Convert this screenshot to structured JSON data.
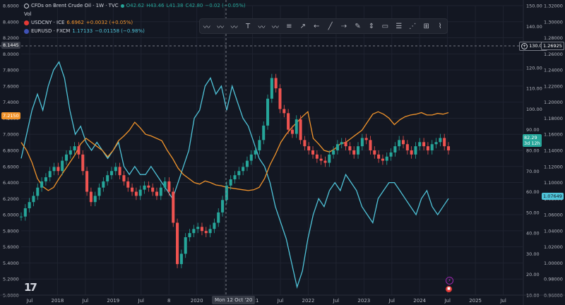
{
  "legend": {
    "main": {
      "title": "CFDs on Brent Crude Oil · 1W · TVC",
      "o": "O42.62",
      "h": "H43.46",
      "l": "L41.38",
      "c": "C42.80",
      "chg": "−0.02 (−0.05%)"
    },
    "vol": "Vol",
    "usdcny": {
      "name": "USDCNY · ICE",
      "value": "6.6962",
      "chg": "+0.0032 (+0.05%)"
    },
    "eurusd": {
      "name": "EURUSD · FXCM",
      "value": "1.17133",
      "chg": "−0.01158 (−0.98%)"
    }
  },
  "toolbar_icons": [
    "wave-icon",
    "wave-icon",
    "wave-icon",
    "text-tool-icon",
    "wave-icon",
    "wave-icon",
    "lines-icon",
    "arrow-diagonal-icon",
    "arrow-left-icon",
    "line-icon",
    "arrow-line-icon",
    "brush-icon",
    "price-range-icon",
    "rectangle-icon",
    "fib-icon",
    "fan-icon",
    "gann-icon",
    "path-icon"
  ],
  "crosshair": {
    "price": "130.05",
    "eur": "1.26925",
    "cny": "8.1445",
    "date": "Mon 12 Oct '20"
  },
  "tags": {
    "usdcny_last": "7.2150",
    "brent_last": "82.29",
    "brent_countdown": "3d 12h",
    "eurusd_last": "1.07649"
  },
  "colors": {
    "bg": "#131722",
    "grid": "#1f2330",
    "up": "#26a69a",
    "down": "#ef5350",
    "usdcny": "#f0932b",
    "eurusd": "#4fc3d8",
    "text": "#b2b5be"
  },
  "chart_data": {
    "type": "line",
    "title": "CFDs on Brent Crude Oil · 1W · TVC",
    "x_ticks": [
      "Jul",
      "2018",
      "Jul",
      "2019",
      "Jul",
      "8",
      "2020",
      "Jul",
      "2021",
      "Jul",
      "2022",
      "Jul",
      "2023",
      "Jul",
      "2024",
      "Jul",
      "2025",
      "Jul"
    ],
    "axes": {
      "usdcny_left": {
        "ticks": [
          "8.6000",
          "8.4000",
          "8.2000",
          "8.0000",
          "7.8000",
          "7.6000",
          "7.4000",
          "7.2000",
          "7.0000",
          "6.8000",
          "6.6000",
          "6.4000",
          "6.2000",
          "6.0000",
          "5.8000",
          "5.6000",
          "5.4000",
          "5.2000",
          "5.0000"
        ],
        "ylim": [
          5.0,
          8.6
        ]
      },
      "brent_right": {
        "ticks": [
          "150.00",
          "140.00",
          "130.00",
          "120.00",
          "110.00",
          "100.00",
          "90.00",
          "80.00",
          "70.00",
          "60.00",
          "50.00",
          "40.00",
          "30.00",
          "20.00",
          "10.00"
        ],
        "ylim": [
          10,
          150
        ]
      },
      "eurusd_right": {
        "ticks": [
          "1.32000",
          "1.30000",
          "1.28000",
          "1.26000",
          "1.24000",
          "1.22000",
          "1.20000",
          "1.18000",
          "1.16000",
          "1.14000",
          "1.12000",
          "1.10000",
          "1.08000",
          "1.06000",
          "1.04000",
          "1.02000",
          "1.00000",
          "0.98000",
          "0.96000"
        ],
        "ylim": [
          0.96,
          1.32
        ]
      }
    },
    "series": [
      {
        "name": "USDCNY",
        "values": [
          6.9,
          6.8,
          6.65,
          6.45,
          6.35,
          6.3,
          6.34,
          6.45,
          6.55,
          6.65,
          6.75,
          6.88,
          6.95,
          6.9,
          6.85,
          6.8,
          6.72,
          6.8,
          6.92,
          6.98,
          7.05,
          7.15,
          7.08,
          7.0,
          6.98,
          6.95,
          6.92,
          6.8,
          6.7,
          6.58,
          6.5,
          6.45,
          6.4,
          6.38,
          6.42,
          6.4,
          6.37,
          6.36,
          6.34,
          6.33,
          6.32,
          6.31,
          6.3,
          6.31,
          6.34,
          6.45,
          6.62,
          6.75,
          6.9,
          7.0,
          7.08,
          7.15,
          7.22,
          7.28,
          6.95,
          6.88,
          6.8,
          6.78,
          6.82,
          6.88,
          6.9,
          6.95,
          7.0,
          7.05,
          7.15,
          7.25,
          7.28,
          7.25,
          7.2,
          7.12,
          7.18,
          7.22,
          7.24,
          7.25,
          7.27,
          7.24,
          7.24,
          7.26,
          7.25,
          7.27
        ]
      },
      {
        "name": "EURUSD",
        "values": [
          1.13,
          1.16,
          1.19,
          1.21,
          1.19,
          1.22,
          1.24,
          1.25,
          1.23,
          1.19,
          1.16,
          1.17,
          1.15,
          1.14,
          1.15,
          1.14,
          1.13,
          1.14,
          1.15,
          1.12,
          1.11,
          1.12,
          1.11,
          1.11,
          1.12,
          1.11,
          1.1,
          1.09,
          1.08,
          1.1,
          1.12,
          1.14,
          1.18,
          1.19,
          1.22,
          1.23,
          1.21,
          1.22,
          1.19,
          1.22,
          1.2,
          1.18,
          1.17,
          1.15,
          1.13,
          1.12,
          1.1,
          1.07,
          1.05,
          1.03,
          1.0,
          0.97,
          0.99,
          1.03,
          1.06,
          1.08,
          1.07,
          1.09,
          1.1,
          1.09,
          1.11,
          1.1,
          1.09,
          1.07,
          1.06,
          1.05,
          1.08,
          1.09,
          1.1,
          1.1,
          1.09,
          1.08,
          1.07,
          1.06,
          1.08,
          1.09,
          1.07,
          1.06,
          1.07,
          1.08
        ]
      },
      {
        "name": "Brent",
        "values": [
          48,
          52,
          55,
          58,
          62,
          65,
          67,
          70,
          72,
          70,
          75,
          78,
          80,
          82,
          78,
          70,
          60,
          55,
          58,
          62,
          65,
          68,
          70,
          72,
          68,
          65,
          62,
          60,
          58,
          61,
          63,
          62,
          60,
          58,
          62,
          65,
          60,
          45,
          25,
          30,
          38,
          40,
          42,
          43,
          41,
          40,
          42,
          45,
          50,
          56,
          63,
          66,
          68,
          70,
          72,
          75,
          78,
          80,
          85,
          92,
          105,
          115,
          110,
          100,
          98,
          90,
          88,
          95,
          85,
          82,
          80,
          78,
          76,
          75,
          74,
          78,
          80,
          83,
          84,
          82,
          80,
          78,
          82,
          86,
          85,
          80,
          78,
          76,
          75,
          77,
          79,
          82,
          85,
          83,
          80,
          78,
          82,
          84,
          82,
          80,
          83,
          84,
          86,
          82,
          80
        ]
      }
    ]
  }
}
